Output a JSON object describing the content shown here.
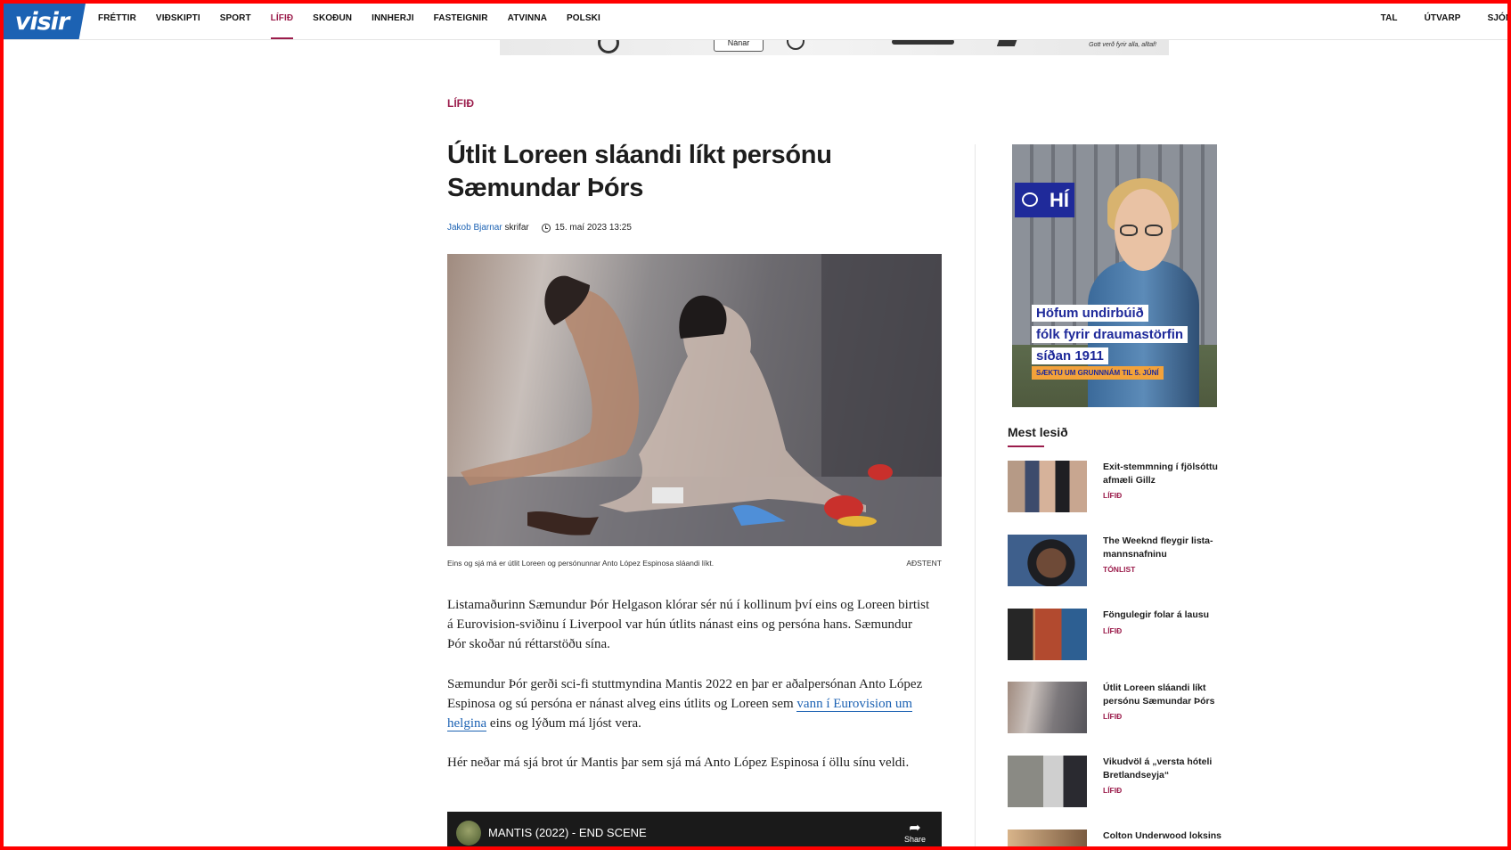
{
  "nav": {
    "logo": "visir",
    "items": [
      "FRÉTTIR",
      "VIÐSKIPTI",
      "SPORT",
      "LÍFIÐ",
      "SKOÐUN",
      "INNHERJI",
      "FASTEIGNIR",
      "ATVINNA",
      "POLSKI"
    ],
    "active": "LÍFIÐ",
    "right_items": [
      "TAL",
      "ÚTVARP",
      "SJÓNV"
    ]
  },
  "top_ad": {
    "button_label": "Nánar",
    "slogan": "Gott verð fyrir alla, alltaf!"
  },
  "article": {
    "section": "LÍFIÐ",
    "title": "Útlit Loreen sláandi líkt persónu Sæmundar Þórs",
    "author": "Jakob Bjarnar",
    "author_suffix": "skrifar",
    "date": "15. maí 2023 13:25",
    "caption": "Eins og sjá má er útlit Loreen og persónunnar Anto López Espinosa sláandi líkt.",
    "credit": "AÐSTENT",
    "p1": "Listamaðurinn Sæmundur Þór Helgason klórar sér nú í kollinum því eins og Loreen birtist á Eurovision-sviðinu í Liverpool var hún útlits nánast eins og persóna hans. Sæmundur Þór skoðar nú réttarstöðu sína.",
    "p2_before": "Sæmundur Þór gerði sci-fi stuttmyndina Mantis 2022 en þar er aðalpersónan Anto López Espinosa og sú persóna er nánast alveg eins útlits og Loreen sem ",
    "p2_link": "vann í Eurovision um helgina",
    "p2_after": " eins og lýðum má ljóst vera.",
    "p3": "Hér neðar má sjá brot úr Mantis þar sem sjá má Anto López Espinosa í öllu sínu veldi.",
    "video_title": "MANTIS (2022) - END SCENE",
    "video_share": "Share"
  },
  "side_ad": {
    "logo": "HÍ",
    "line1": "Höfum undirbúið",
    "line2": "fólk fyrir draumastörfin",
    "line3": "síðan 1911",
    "cta": "SÆKTU UM GRUNNNÁM TIL 5. JÚNÍ",
    "brand_color": "#1f2a9a"
  },
  "most_read": {
    "title": "Mest lesið",
    "items": [
      {
        "title": "Exit-stemmning í fjölsóttu afmæli Gillz",
        "category": "LÍFIÐ"
      },
      {
        "title": "The Weeknd fleygir lista-mannsnafninu",
        "category": "TÓNLIST"
      },
      {
        "title": "Föngulegir folar á lausu",
        "category": "LÍFIÐ"
      },
      {
        "title": "Útlit Loreen sláandi líkt persónu Sæmundar Þórs",
        "category": "LÍFIÐ"
      },
      {
        "title": "Vikudvöl á „versta hóteli Bretlandseyja“",
        "category": "LÍFIÐ"
      },
      {
        "title": "Colton Underwood loksins",
        "category": ""
      }
    ]
  },
  "colors": {
    "accent": "#9b1c4b",
    "link": "#1c62b3",
    "brand": "#1c62b3"
  }
}
